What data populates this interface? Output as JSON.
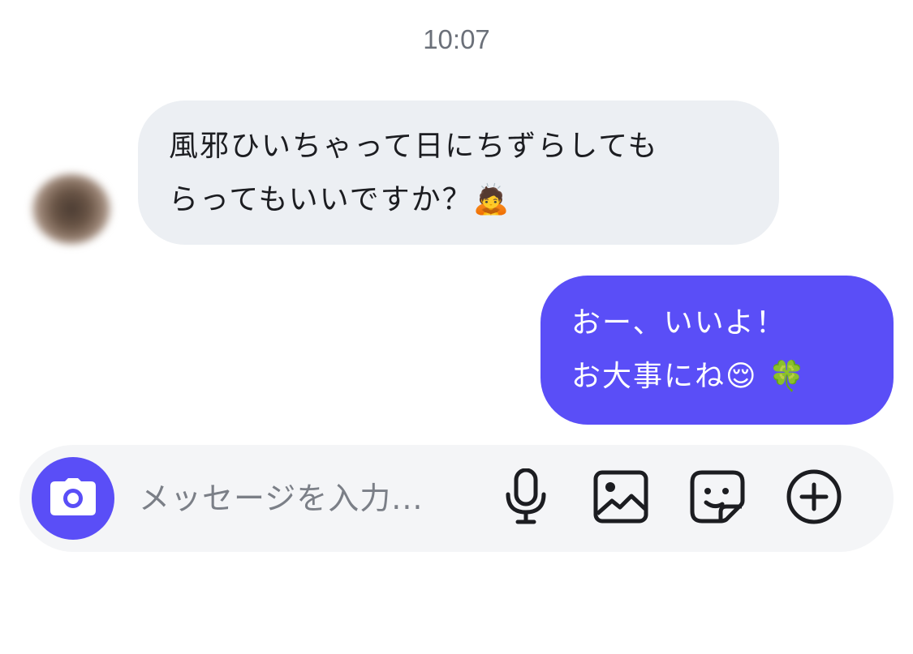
{
  "timestamp": "10:07",
  "incoming": {
    "lines": [
      "風邪ひいちゃって日にちずらしても",
      "らってもいいですか？🙇"
    ]
  },
  "outgoing": {
    "lines": [
      "おー、いいよ！",
      "お大事にね😌 🍀"
    ]
  },
  "composer": {
    "placeholder": "メッセージを入力..."
  },
  "icons": {
    "camera": "camera-icon",
    "mic": "microphone-icon",
    "image": "image-icon",
    "sticker": "sticker-icon",
    "plus": "plus-circle-icon"
  },
  "colors": {
    "accent": "#5a4ef7",
    "incoming_bubble": "#eceff3",
    "composer_bg": "#f4f5f7",
    "icon": "#1c1d21"
  }
}
